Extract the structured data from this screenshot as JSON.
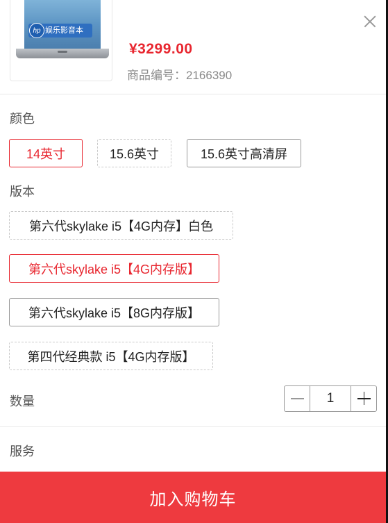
{
  "product": {
    "price": "¥3299.00",
    "sku_label": "商品编号：",
    "sku_value": "2166390",
    "image_promo_text": "娱乐影音本",
    "image_brand": "hp"
  },
  "color": {
    "label": "颜色",
    "options": [
      {
        "text": "14英寸",
        "state": "selected"
      },
      {
        "text": "15.6英寸",
        "state": "unavailable"
      },
      {
        "text": "15.6英寸高清屏",
        "state": "available"
      }
    ]
  },
  "version": {
    "label": "版本",
    "options": [
      {
        "text": "第六代skylake i5【4G内存】白色",
        "state": "unavailable"
      },
      {
        "text": "第六代skylake i5【4G内存版】",
        "state": "selected"
      },
      {
        "text": "第六代skylake i5【8G内存版】",
        "state": "available"
      },
      {
        "text": "第四代经典款 i5【4G内存版】",
        "state": "unavailable"
      }
    ]
  },
  "quantity": {
    "label": "数量",
    "value": "1"
  },
  "service": {
    "label": "服务"
  },
  "actions": {
    "add_to_cart": "加入购物车"
  },
  "icons": {
    "close": "close-icon",
    "minus": "minus-icon",
    "plus": "plus-icon"
  },
  "colors": {
    "accent": "#e8262f",
    "cart_button": "#ee3a3f",
    "muted_text": "#8a8a8a"
  }
}
